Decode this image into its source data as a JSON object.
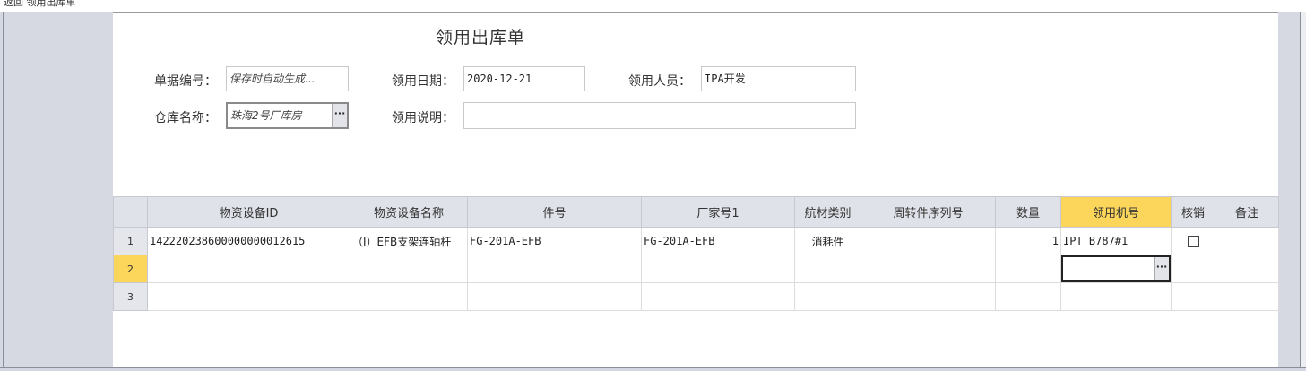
{
  "window": {
    "title_fragment": "返回 领用出库单"
  },
  "form": {
    "title": "领用出库单",
    "doc_no": {
      "label": "单据编号：",
      "placeholder": "保存时自动生成..."
    },
    "date": {
      "label": "领用日期：",
      "value": "2020-12-21"
    },
    "person": {
      "label": "领用人员：",
      "value": "IPA开发"
    },
    "warehouse": {
      "label": "仓库名称：",
      "value": "珠海2号厂库房",
      "button": "···"
    },
    "note": {
      "label": "领用说明：",
      "value": ""
    }
  },
  "grid": {
    "columns": [
      "物资设备ID",
      "物资设备名称",
      "件号",
      "厂家号1",
      "航材类别",
      "周转件序列号",
      "数量",
      "领用机号",
      "核销",
      "备注"
    ],
    "highlight_column": "领用机号",
    "rows": [
      {
        "num": "1",
        "id": "142220238600000000012615",
        "name": "（I）EFB支架连轴杆",
        "part_no": "FG-201A-EFB",
        "mfr_no": "FG-201A-EFB",
        "category": "消耗件",
        "serial": "",
        "qty": "1",
        "aircraft": "IPT B787#1",
        "verified": false,
        "remark": ""
      },
      {
        "num": "2",
        "id": "",
        "name": "",
        "part_no": "",
        "mfr_no": "",
        "category": "",
        "serial": "",
        "qty": "",
        "aircraft": "",
        "verified": null,
        "remark": "",
        "current": true
      },
      {
        "num": "3",
        "id": "",
        "name": "",
        "part_no": "",
        "mfr_no": "",
        "category": "",
        "serial": "",
        "qty": "",
        "aircraft": "",
        "verified": null,
        "remark": ""
      }
    ],
    "editor_button": "···"
  }
}
